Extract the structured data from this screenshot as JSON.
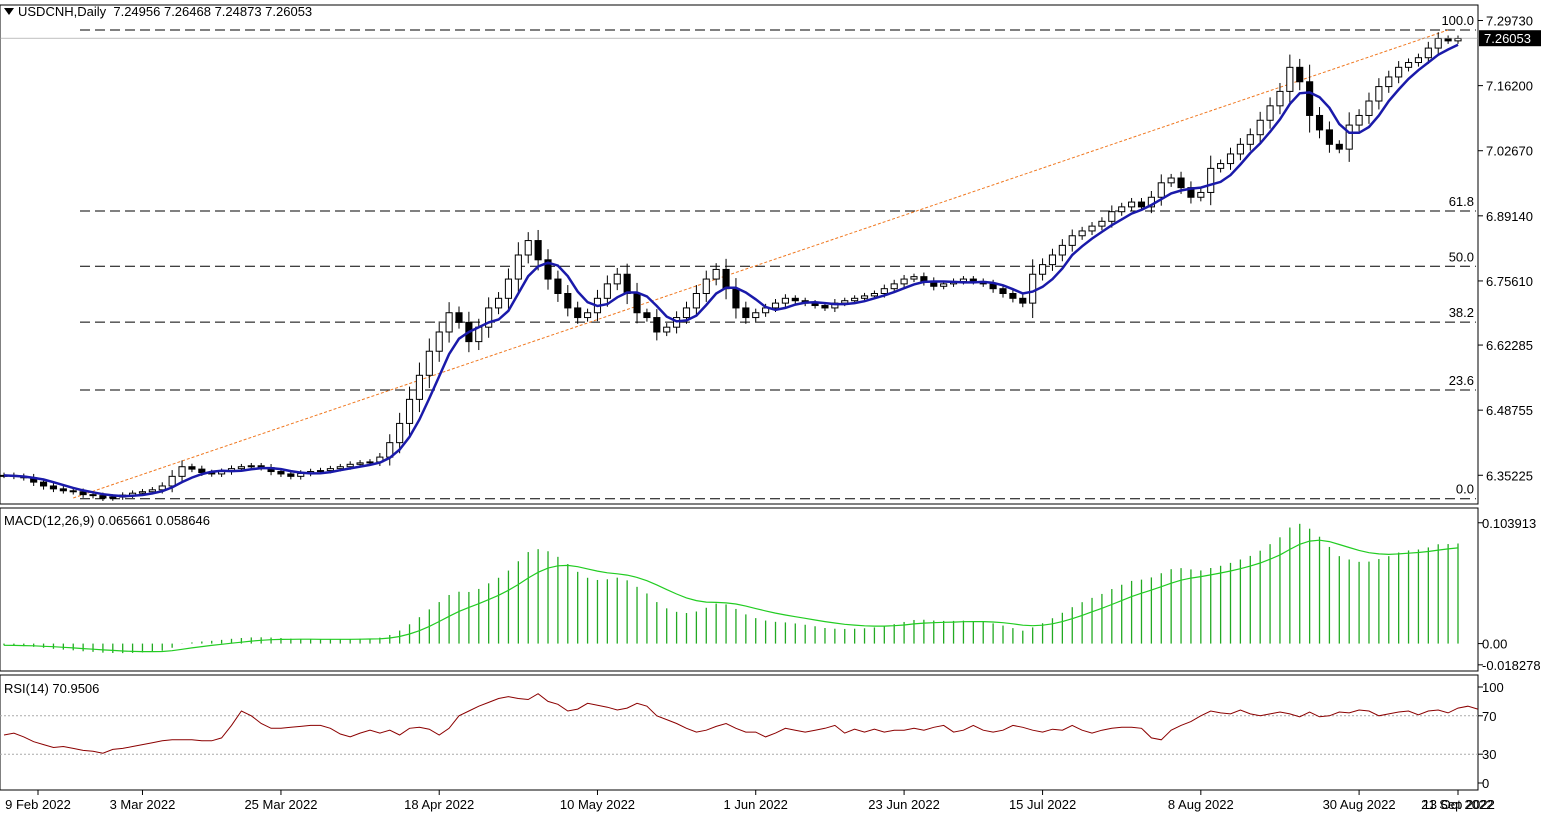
{
  "header": {
    "symbol": "USDCNH,Daily",
    "ohlc": "7.24956 7.26468 7.24873 7.26053",
    "macd_label": "MACD(12,26,9) 0.065661 0.058646",
    "rsi_label": "RSI(14) 70.9506"
  },
  "chart_data": [
    {
      "type": "candlestick",
      "title": "USDCNH,Daily",
      "x": [
        "9 Feb 2022",
        "3 Mar 2022",
        "25 Mar 2022",
        "18 Apr 2022",
        "10 May 2022",
        "1 Jun 2022",
        "23 Jun 2022",
        "15 Jul 2022",
        "8 Aug 2022",
        "30 Aug 2022",
        "21 Sep 2022",
        "13 Oct 2022"
      ],
      "ylim": [
        6.305,
        7.315
      ],
      "y_ticks": [
        "7.29730",
        "7.16200",
        "7.02670",
        "6.89140",
        "6.75610",
        "6.62285",
        "6.48755",
        "6.35225"
      ],
      "current_price": "7.26053",
      "fib_levels": [
        {
          "label": "100.0",
          "value": 7.2775
        },
        {
          "label": "61.8",
          "value": 6.9015
        },
        {
          "label": "50.0",
          "value": 6.7865
        },
        {
          "label": "38.2",
          "value": 6.6705
        },
        {
          "label": "23.6",
          "value": 6.5295
        },
        {
          "label": "0.0",
          "value": 6.3035
        }
      ],
      "close": [
        6.352,
        6.35,
        6.347,
        6.338,
        6.33,
        6.324,
        6.32,
        6.318,
        6.312,
        6.31,
        6.305,
        6.307,
        6.311,
        6.315,
        6.318,
        6.322,
        6.33,
        6.35,
        6.37,
        6.365,
        6.358,
        6.355,
        6.36,
        6.366,
        6.37,
        6.372,
        6.368,
        6.36,
        6.355,
        6.35,
        6.356,
        6.36,
        6.362,
        6.366,
        6.37,
        6.375,
        6.378,
        6.38,
        6.39,
        6.42,
        6.46,
        6.51,
        6.56,
        6.61,
        6.65,
        6.69,
        6.67,
        6.63,
        6.66,
        6.7,
        6.72,
        6.76,
        6.81,
        6.84,
        6.8,
        6.76,
        6.73,
        6.7,
        6.68,
        6.69,
        6.72,
        6.75,
        6.77,
        6.73,
        6.69,
        6.68,
        6.65,
        6.66,
        6.68,
        6.7,
        6.73,
        6.76,
        6.78,
        6.74,
        6.7,
        6.68,
        6.69,
        6.7,
        6.71,
        6.72,
        6.715,
        6.71,
        6.705,
        6.7,
        6.71,
        6.715,
        6.72,
        6.725,
        6.73,
        6.74,
        6.75,
        6.76,
        6.765,
        6.755,
        6.745,
        6.75,
        6.755,
        6.76,
        6.755,
        6.75,
        6.74,
        6.73,
        6.72,
        6.71,
        6.77,
        6.79,
        6.81,
        6.83,
        6.85,
        6.86,
        6.87,
        6.88,
        6.9,
        6.91,
        6.92,
        6.91,
        6.93,
        6.96,
        6.97,
        6.95,
        6.93,
        6.94,
        6.99,
        7.0,
        7.02,
        7.04,
        7.06,
        7.09,
        7.12,
        7.15,
        7.2,
        7.17,
        7.1,
        7.07,
        7.04,
        7.03,
        7.08,
        7.1,
        7.13,
        7.16,
        7.18,
        7.2,
        7.21,
        7.22,
        7.24,
        7.26,
        7.255,
        7.26
      ],
      "ma_period": 5,
      "trendline": [
        [
          7,
          6.305
        ],
        [
          146,
          7.2775
        ]
      ]
    },
    {
      "type": "line",
      "title": "MACD(12,26,9) 0.065661 0.058646",
      "ylim": [
        -0.021,
        0.108
      ],
      "y_ticks": [
        "0.103913",
        "0.00",
        "-0.018278"
      ],
      "series": [
        {
          "name": "MACD",
          "values": [
            -0.0015,
            -0.0018,
            -0.0022,
            -0.0028,
            -0.0036,
            -0.0045,
            -0.0052,
            -0.0058,
            -0.0066,
            -0.0071,
            -0.0078,
            -0.0081,
            -0.0082,
            -0.008,
            -0.0076,
            -0.0071,
            -0.0061,
            -0.0036,
            -0.0002,
            0.001,
            0.0018,
            0.0024,
            0.0032,
            0.0041,
            0.0048,
            0.0053,
            0.0054,
            0.0052,
            0.0048,
            0.0042,
            0.0039,
            0.0037,
            0.0036,
            0.0036,
            0.0037,
            0.0039,
            0.0041,
            0.0043,
            0.0051,
            0.0074,
            0.0112,
            0.0166,
            0.0227,
            0.0294,
            0.0357,
            0.0418,
            0.0446,
            0.0444,
            0.047,
            0.0518,
            0.0566,
            0.0628,
            0.0708,
            0.0787,
            0.0812,
            0.0794,
            0.0746,
            0.0684,
            0.0617,
            0.0566,
            0.0547,
            0.0553,
            0.0567,
            0.0544,
            0.0488,
            0.0431,
            0.0357,
            0.0303,
            0.0273,
            0.0263,
            0.0276,
            0.0308,
            0.0344,
            0.0337,
            0.0298,
            0.0251,
            0.0219,
            0.0198,
            0.0187,
            0.0182,
            0.0173,
            0.0162,
            0.0149,
            0.0134,
            0.0128,
            0.0126,
            0.0128,
            0.0132,
            0.0139,
            0.0151,
            0.0167,
            0.0186,
            0.0203,
            0.0205,
            0.0198,
            0.0195,
            0.0195,
            0.0197,
            0.0194,
            0.0188,
            0.0174,
            0.0155,
            0.0133,
            0.0111,
            0.0139,
            0.0175,
            0.0218,
            0.0265,
            0.0313,
            0.0356,
            0.0393,
            0.0427,
            0.0469,
            0.0506,
            0.0539,
            0.055,
            0.0569,
            0.0605,
            0.064,
            0.0649,
            0.0638,
            0.0629,
            0.065,
            0.0669,
            0.0694,
            0.0723,
            0.0754,
            0.0799,
            0.0855,
            0.0914,
            0.0998,
            0.103,
            0.0988,
            0.0919,
            0.0831,
            0.0752,
            0.0723,
            0.0703,
            0.0705,
            0.0727,
            0.0752,
            0.0783,
            0.0801,
            0.0809,
            0.0827,
            0.0854,
            0.0856,
            0.0861
          ]
        },
        {
          "name": "Signal",
          "values": [
            -0.0015,
            -0.0016,
            -0.0017,
            -0.0019,
            -0.0023,
            -0.0027,
            -0.0032,
            -0.0037,
            -0.0043,
            -0.0048,
            -0.0054,
            -0.0059,
            -0.0064,
            -0.0067,
            -0.0069,
            -0.0069,
            -0.0068,
            -0.0061,
            -0.0049,
            -0.0037,
            -0.0026,
            -0.0016,
            -0.0006,
            0.0003,
            0.0012,
            0.0021,
            0.0028,
            0.0033,
            0.0036,
            0.0037,
            0.0038,
            0.0038,
            0.0037,
            0.0037,
            0.0037,
            0.0037,
            0.0038,
            0.0039,
            0.0041,
            0.0048,
            0.0061,
            0.0082,
            0.0111,
            0.0148,
            0.019,
            0.0235,
            0.0277,
            0.0311,
            0.0343,
            0.0378,
            0.0415,
            0.0458,
            0.0508,
            0.0564,
            0.0613,
            0.0649,
            0.0669,
            0.0672,
            0.0661,
            0.0642,
            0.0623,
            0.0609,
            0.06,
            0.0589,
            0.0569,
            0.0541,
            0.0505,
            0.0464,
            0.0426,
            0.0393,
            0.037,
            0.0357,
            0.0354,
            0.035,
            0.034,
            0.0322,
            0.0301,
            0.0281,
            0.0262,
            0.0246,
            0.0231,
            0.0217,
            0.0203,
            0.0189,
            0.0177,
            0.0166,
            0.0159,
            0.0153,
            0.015,
            0.015,
            0.0154,
            0.016,
            0.0169,
            0.0176,
            0.018,
            0.0183,
            0.0185,
            0.0188,
            0.0189,
            0.0189,
            0.0186,
            0.018,
            0.017,
            0.0158,
            0.0154,
            0.0158,
            0.017,
            0.0189,
            0.0214,
            0.0242,
            0.0273,
            0.0303,
            0.0336,
            0.037,
            0.0404,
            0.0433,
            0.046,
            0.0489,
            0.0519,
            0.0545,
            0.0563,
            0.0576,
            0.0591,
            0.0607,
            0.0624,
            0.0644,
            0.0666,
            0.0693,
            0.0726,
            0.0763,
            0.081,
            0.0854,
            0.0881,
            0.0889,
            0.0877,
            0.0852,
            0.0826,
            0.0801,
            0.0782,
            0.0771,
            0.0767,
            0.0771,
            0.0777,
            0.0783,
            0.0792,
            0.0804,
            0.0814,
            0.0823
          ]
        }
      ]
    },
    {
      "type": "line",
      "title": "RSI(14) 70.9506",
      "ylim": [
        0,
        100
      ],
      "y_ticks": [
        "100",
        "70",
        "30",
        "0"
      ],
      "series": [
        {
          "name": "RSI(14)",
          "values": [
            50,
            52,
            48,
            43,
            40,
            37,
            38,
            36,
            34,
            33,
            31,
            35,
            36,
            38,
            40,
            42,
            44,
            45,
            45,
            45,
            44,
            44,
            47,
            60,
            75,
            70,
            62,
            57,
            57,
            58,
            59,
            60,
            60,
            57,
            51,
            48,
            52,
            55,
            52,
            55,
            50,
            57,
            58,
            56,
            50,
            57,
            70,
            75,
            80,
            84,
            88,
            90,
            88,
            87,
            93,
            85,
            82,
            75,
            77,
            83,
            81,
            79,
            76,
            78,
            83,
            80,
            70,
            66,
            62,
            57,
            53,
            55,
            59,
            62,
            57,
            53,
            53,
            48,
            52,
            57,
            55,
            53,
            55,
            57,
            60,
            52,
            56,
            53,
            56,
            53,
            55,
            55,
            57,
            55,
            58,
            60,
            53,
            55,
            60,
            55,
            53,
            55,
            60,
            58,
            55,
            53,
            56,
            55,
            60,
            55,
            52,
            55,
            57,
            58,
            58,
            57,
            47,
            45,
            55,
            60,
            64,
            70,
            75,
            73,
            72,
            76,
            72,
            70,
            72,
            74,
            72,
            69,
            74,
            69,
            70,
            74,
            73,
            76,
            75,
            70,
            72,
            74,
            75,
            71,
            75,
            76,
            73,
            78,
            80,
            77
          ]
        }
      ],
      "levels": [
        30,
        70
      ]
    }
  ],
  "price_axis": {
    "ticks": [
      "7.29730",
      "7.16200",
      "7.02670",
      "6.89140",
      "6.75610",
      "6.62285",
      "6.48755",
      "6.35225"
    ],
    "current": "7.26053"
  },
  "macd_axis": {
    "ticks": [
      "0.103913",
      "0.00",
      "-0.018278"
    ]
  },
  "rsi_axis": {
    "ticks": [
      "100",
      "70",
      "30",
      "0"
    ]
  },
  "date_axis": {
    "ticks": [
      "9 Feb 2022",
      "3 Mar 2022",
      "25 Mar 2022",
      "18 Apr 2022",
      "10 May 2022",
      "1 Jun 2022",
      "23 Jun 2022",
      "15 Jul 2022",
      "8 Aug 2022",
      "30 Aug 2022",
      "21 Sep 2022",
      "13 Oct 2022"
    ]
  },
  "colors": {
    "ma": "#1a1aaa",
    "trend": "#f07820",
    "macd_bar": "#22aa22",
    "signal": "#22cc22",
    "rsi": "#8b0000",
    "grid_dash": "#000000",
    "bull": "#ffffff",
    "bear": "#000000"
  }
}
